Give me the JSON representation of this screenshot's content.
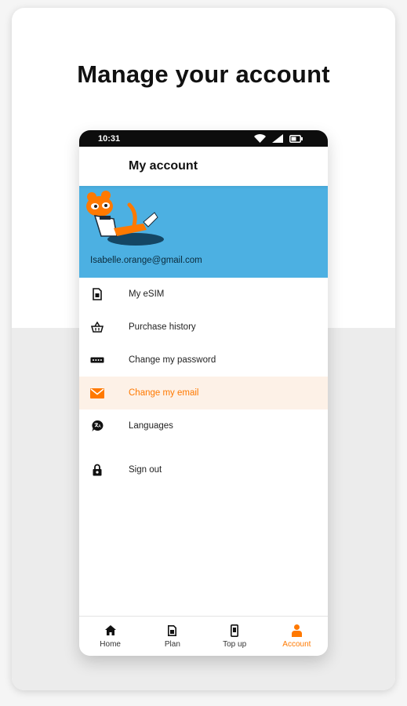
{
  "headline": "Manage your account",
  "status_bar": {
    "time": "10:31"
  },
  "appbar": {
    "title": "My account"
  },
  "profile": {
    "email": "Isabelle.orange@gmail.com"
  },
  "menu": [
    {
      "label": "My eSIM",
      "icon": "sim-icon"
    },
    {
      "label": "Purchase history",
      "icon": "basket-icon"
    },
    {
      "label": "Change my password",
      "icon": "password-icon"
    },
    {
      "label": "Change my email",
      "icon": "envelope-icon",
      "active": true
    },
    {
      "label": "Languages",
      "icon": "language-bubble-icon"
    },
    {
      "label": "Sign out",
      "icon": "lock-icon"
    }
  ],
  "tabs": [
    {
      "label": "Home",
      "icon": "home-icon"
    },
    {
      "label": "Plan",
      "icon": "sim-icon"
    },
    {
      "label": "Top up",
      "icon": "phone-icon"
    },
    {
      "label": "Account",
      "icon": "person-icon",
      "active": true
    }
  ],
  "colors": {
    "accent": "#ff7900",
    "hero_bg": "#4cb0e2",
    "active_row_bg": "#fdf1e7"
  }
}
